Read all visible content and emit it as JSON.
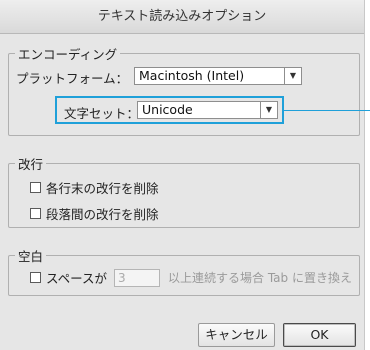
{
  "dialog": {
    "title": "テキスト読み込みオプション"
  },
  "encoding": {
    "legend": "エンコーディング",
    "platform_label": "プラットフォーム：",
    "platform_value": "Macintosh (Intel)",
    "charset_label": "文字セット：",
    "charset_value": "Unicode"
  },
  "line_breaks": {
    "legend": "改行",
    "remove_line_end": "各行末の改行を削除",
    "remove_between_paragraphs": "段落間の改行を削除"
  },
  "spaces": {
    "legend": "空白",
    "replace_label": "スペースが",
    "count_value": "3",
    "replace_suffix": "以上連続する場合 Tab に置き換え"
  },
  "buttons": {
    "cancel": "キャンセル",
    "ok": "OK"
  },
  "colors": {
    "highlight": "#1fa0d9"
  }
}
